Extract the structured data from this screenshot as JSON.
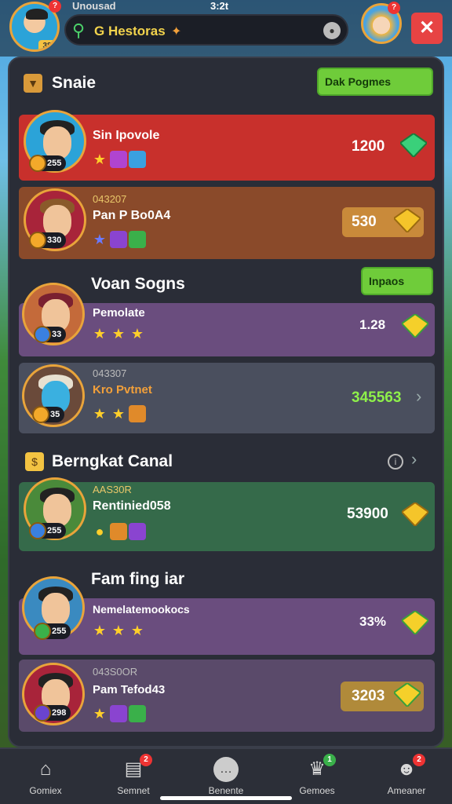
{
  "status": {
    "title": "Unousad",
    "time": "3:2t"
  },
  "header": {
    "player_level": "38",
    "search_text": "G Hestoras",
    "search_badge": "✦",
    "close_label": "✕"
  },
  "section1": {
    "title": "Snaie",
    "button": "Dak Pogmes",
    "rows": [
      {
        "subtitle": "",
        "name": "Sin Ipovole",
        "level": "255",
        "score": "1200",
        "bg": "#c8302c"
      },
      {
        "subtitle": "043207",
        "name": "Pan P Bo0A4",
        "level": "330",
        "score": "530",
        "bg": "#8a4a2a"
      }
    ]
  },
  "section2": {
    "title": "Voan Sogns",
    "button": "Inpaos",
    "rows": [
      {
        "subtitle": "",
        "name": "Pemolate",
        "level": "33",
        "score": "1.28",
        "bg": "#6a4d7e"
      },
      {
        "subtitle": "043307",
        "name": "Kro Pvtnet",
        "level": "35",
        "score": "345563",
        "bg": "#4a4f5e"
      }
    ]
  },
  "section3": {
    "title": "Berngkat Canal",
    "rows": [
      {
        "subtitle": "AAS30R",
        "name": "Rentinied058",
        "level": "255",
        "score": "53900",
        "bg": "#356a4a"
      }
    ]
  },
  "section4": {
    "title": "Fam fing iar",
    "rows": [
      {
        "subtitle": "",
        "name": "Nemelatemookocs",
        "level": "255",
        "score": "33%",
        "bg": "#6a4d7e"
      },
      {
        "subtitle": "043S0OR",
        "name": "Pam Tefod43",
        "level": "298",
        "score": "3203",
        "bg": "#5a4a6a"
      }
    ]
  },
  "nav": [
    {
      "label": "Gomiex",
      "icon": "home-icon",
      "badge": ""
    },
    {
      "label": "Semnet",
      "icon": "inbox-icon",
      "badge": "2"
    },
    {
      "label": "Benente",
      "icon": "chat-icon",
      "badge": ""
    },
    {
      "label": "Gemoes",
      "icon": "trophy-icon",
      "badge": "1"
    },
    {
      "label": "Ameaner",
      "icon": "profile-icon",
      "badge": "2"
    }
  ],
  "colors": {
    "accent_green": "#6fcc3a",
    "panel": "#2a2d37",
    "gold": "#f3a92a",
    "close_red": "#e74343"
  }
}
